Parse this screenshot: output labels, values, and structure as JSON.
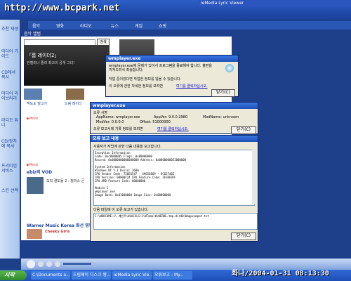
{
  "watermark": "http://www.bcpark.net",
  "mini_player_title": "ieMedia Lyric Viewer",
  "tabs": [
    "음악",
    "영화",
    "라디오",
    "뉴스",
    "게임",
    "쇼핑"
  ],
  "taskpane": [
    "추천 재생",
    "미디어 가이드",
    "CD에서 복사",
    "미디어 라이브러리",
    "라디오 튜너",
    "CD/장치에 복사",
    "프리미엄 서비스",
    "스킨 선택"
  ],
  "content": {
    "section": "음악 앨범",
    "search_button": "검색",
    "promo": "「롬 레이더2」",
    "promo_sub": "안젤리나 졸리 최고의 공개 그녀!",
    "thumb1": "맥도도 말고가",
    "thumb2": "드림 레이더",
    "more1": "▶More",
    "more2": "▶More",
    "vod_title": "ebiz의 VOD",
    "vod_item": "오직 결도들 2 : 질라스 군",
    "warner": "Warner Music Korea 화선 영향",
    "cheeky": "Cheeky Girls"
  },
  "dialog1": {
    "title": "wmplayer.exe",
    "message": "wmplayer.exe에 문제가 있어서 프로그램을 종료해야 합니다. 불편을 끼쳐드려서 죄송합니다.",
    "line2": "작업 중이었다면 작업한 정보를 잃을 수 있습니다.",
    "line3": "이 오류에 관한 자세한 정보를 보려면",
    "link": "여기를 클릭하십시오.",
    "close": "닫기(C)"
  },
  "dialog2": {
    "title": "wmplayer.exe",
    "sig": "오류 서명",
    "appname": "AppName: wmplayer.exe",
    "appver": "AppVer: 9.0.0.2980",
    "modname": "ModName: unknown",
    "modver": "ModVer: 0.0.0.0",
    "offset": "Offset: 51000000",
    "data_line": "오류 보고서에 기록 정보를 보려면",
    "link": "여기를 클릭하십시오.",
    "close": "닫기(C)"
  },
  "dialog3": {
    "title": "오류 보고 내용",
    "desc": "사용자가 작업에 관한 다음 내용을 보고합니다.",
    "report": [
      "Exception Information",
      "Code: 0xc0000005   Flags: 0x00000000",
      "Record: 0x0000000000000000  Address: 0x0000000051000000",
      "",
      "System Information",
      "Windows NT 5.1 Build: 2600",
      "CPU Vendor Code: 756E6547 - 49656E69 - 6C65746E",
      "CPU Version: 00000F24  CPU Feature Code: 3FEBFBFF",
      "CPU AMD Feature Code: 00000000",
      "",
      "Module 1",
      "wmplayer.exe",
      "Image Base: 0x01000000  Image Size: 0x00000000"
    ],
    "files_label": "다음 파일에 이 오류 보고가 있습니다.",
    "file_path": "C:\\WDOCUME~1\\ 예빈주\\WLOCALS~1\\WTemp\\W\\WERDE.tmp.dir00\\Wappcompat.txt",
    "close": "닫기(C)"
  },
  "taskbar": {
    "start": "시작",
    "tasks": [
      "C:\\Documents a...",
      "드림페이 디스크 짱...",
      "ieMedia Lyric Vie...",
      "오류보고 - My..."
    ],
    "clock": "화나/2004-01-31 08:13:30"
  }
}
